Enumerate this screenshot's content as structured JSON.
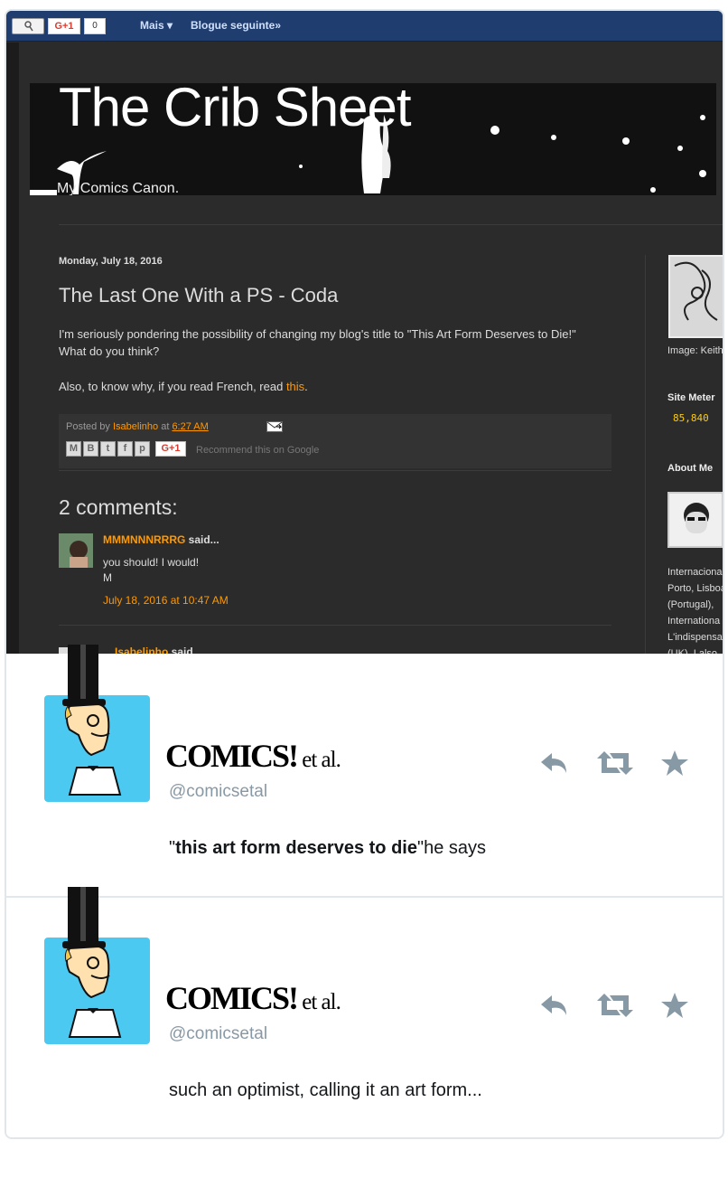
{
  "navbar": {
    "gplus_label": "G+1",
    "gplus_count": "0",
    "more_label": "Mais ▾",
    "next_blog_label": "Blogue seguinte»"
  },
  "blog": {
    "title": "The Crib Sheet",
    "subtitle": "My Comics Canon.",
    "post": {
      "date": "Monday, July 18, 2016",
      "title": "The Last One With a PS - Coda",
      "paragraph1": "I'm seriously pondering the possibility of changing my blog's title to \"This Art Form Deserves to Die!\" What do you think?",
      "paragraph2_prefix": "Also, to know why, if you read French, read ",
      "paragraph2_link": "this",
      "paragraph2_suffix": ".",
      "posted_by_prefix": "Posted by ",
      "author": "Isabelinho",
      "posted_at": " at ",
      "time": "6:27 AM",
      "share_gplus": "G+1",
      "recommend": "Recommend this on Google"
    },
    "comments": {
      "heading": "2 comments:",
      "items": [
        {
          "author": "MMMNNNRRRG",
          "said": " said...",
          "text_line1": "you should! I would!",
          "text_line2": "M",
          "timestamp": "July 18, 2016 at 10:47 AM"
        },
        {
          "author": "Isabelinho",
          "said": " said..."
        }
      ]
    },
    "sidebar": {
      "image_caption": "Image: Keith Haring",
      "site_meter_heading": "Site Meter",
      "site_meter_value": "85,840",
      "about_heading": "About Me",
      "bio_lines": [
        "Internacional",
        "Porto, Lisboa",
        "(Portugal),",
        "Internationa",
        "L'indispensa",
        "(UK). I also"
      ]
    }
  },
  "tweets": [
    {
      "name_main": "COMICS!",
      "name_suffix": " et al.",
      "handle": "@comicsetal",
      "text_open": "\"",
      "text_bold": "this art form deserves to die",
      "text_rest": "\"he says"
    },
    {
      "name_main": "COMICS!",
      "name_suffix": " et al.",
      "handle": "@comicsetal",
      "text": "such an optimist, calling it an art form..."
    }
  ],
  "colors": {
    "accent": "#ff9900",
    "twitter_icon": "#8899a6",
    "avatar_bg": "#4cc9f0"
  },
  "icons": {
    "reply": "reply-icon",
    "retweet": "retweet-icon",
    "favorite": "star-icon"
  }
}
